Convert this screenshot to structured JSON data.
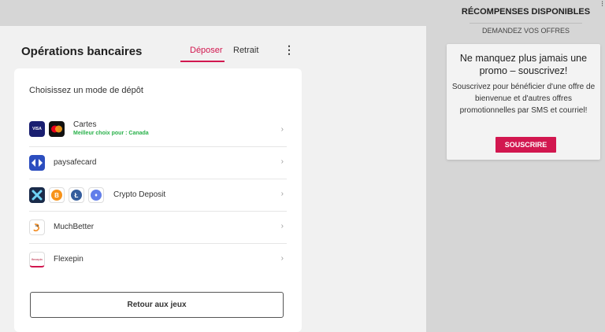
{
  "header": {
    "title": "Opérations bancaires",
    "tabs": [
      {
        "label": "Déposer",
        "active": true
      },
      {
        "label": "Retrait",
        "active": false
      }
    ]
  },
  "deposit": {
    "heading": "Choisissez un mode de dépôt",
    "methods": [
      {
        "label": "Cartes",
        "sub": "Meilleur choix pour : Canada",
        "icons": [
          "visa-icon",
          "mastercard-icon"
        ]
      },
      {
        "label": "paysafecard",
        "icons": [
          "paysafecard-icon"
        ]
      },
      {
        "label": "Crypto Deposit",
        "icons": [
          "crypto-x-icon",
          "bitcoin-icon",
          "litecoin-icon",
          "ethereum-icon"
        ]
      },
      {
        "label": "MuchBetter",
        "icons": [
          "muchbetter-icon"
        ]
      },
      {
        "label": "Flexepin",
        "icons": [
          "flexepin-icon"
        ]
      }
    ],
    "back_label": "Retour aux jeux"
  },
  "rewards": {
    "title": "RÉCOMPENSES DISPONIBLES",
    "subtitle": "DEMANDEZ VOS OFFRES",
    "promo": {
      "heading": "Ne manquez plus jamais une promo – souscrivez!",
      "body": "Souscrivez pour bénéficier d'une offre de bienvenue et d'autres offres promotionnelles par SMS et courriel!",
      "button": "SOUSCRIRE"
    }
  },
  "icons": {
    "visa_text": "VISA",
    "flexepin_text": "flexepin",
    "bitcoin_glyph": "B",
    "litecoin_glyph": "Ł",
    "ethereum_glyph": "♦",
    "chevron": "›",
    "kebab": "⋮"
  },
  "colors": {
    "accent": "#d2174f",
    "green": "#29b14a"
  }
}
